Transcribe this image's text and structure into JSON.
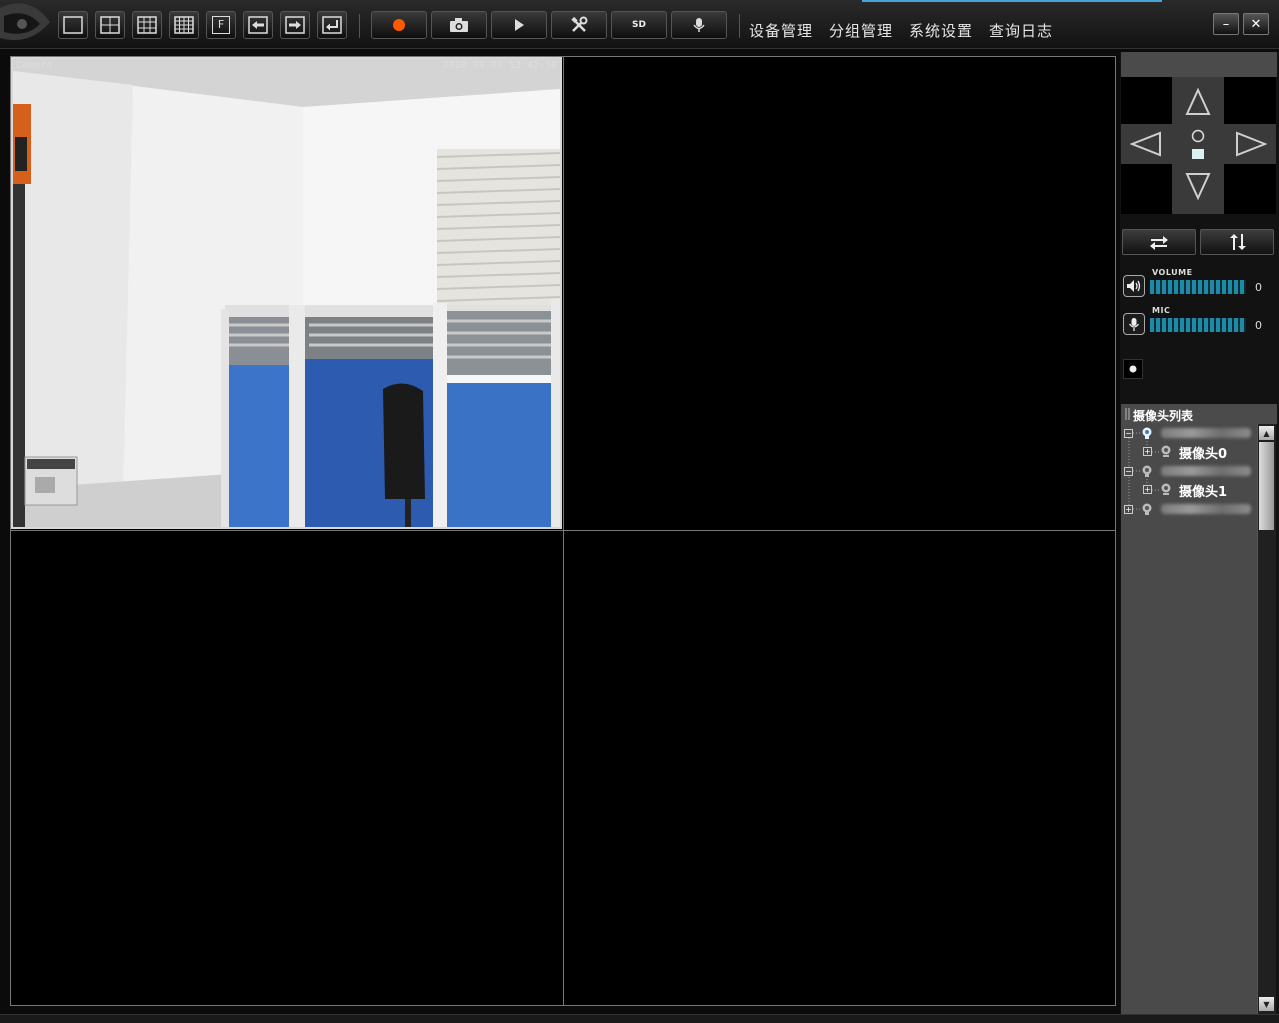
{
  "toolbar": {
    "layout_buttons": [
      {
        "name": "layout-1-button",
        "icon": "single-view-icon"
      },
      {
        "name": "layout-4-button",
        "icon": "quad-view-icon"
      },
      {
        "name": "layout-9-button",
        "icon": "nine-view-icon"
      },
      {
        "name": "layout-16-button",
        "icon": "sixteen-view-icon"
      },
      {
        "name": "fullscreen-button",
        "icon": "fullscreen-icon",
        "label": "F"
      },
      {
        "name": "previous-page-button",
        "icon": "arrow-left-icon"
      },
      {
        "name": "next-page-button",
        "icon": "arrow-right-icon"
      },
      {
        "name": "return-button",
        "icon": "return-icon"
      }
    ],
    "action_buttons": [
      {
        "name": "record-button",
        "icon": "record-icon",
        "color": "#ff5a00"
      },
      {
        "name": "snapshot-button",
        "icon": "camera-icon"
      },
      {
        "name": "play-button",
        "icon": "play-icon"
      },
      {
        "name": "tools-button",
        "icon": "tools-icon"
      },
      {
        "name": "sd-button",
        "icon": "sd-card-icon",
        "label": "SD"
      },
      {
        "name": "microphone-button",
        "icon": "microphone-icon"
      }
    ]
  },
  "menu": {
    "device_management": "设备管理",
    "group_management": "分组管理",
    "system_settings": "系统设置",
    "query_log": "查询日志"
  },
  "window": {
    "minimize": "–",
    "close": "✕"
  },
  "video": {
    "cam0_label": "Camera",
    "cam0_timestamp": "2010-09-07 13:42:30"
  },
  "audio": {
    "volume_label": "VOLUME",
    "volume_value": "0",
    "mic_label": "MIC",
    "mic_value": "0"
  },
  "camera_list": {
    "title": "摄像头列表",
    "cameras": [
      "摄像头0",
      "摄像头1"
    ]
  },
  "colors": {
    "accent": "#4aa3d8",
    "level_bar": "#1f8aa5",
    "record": "#ff5a00"
  }
}
